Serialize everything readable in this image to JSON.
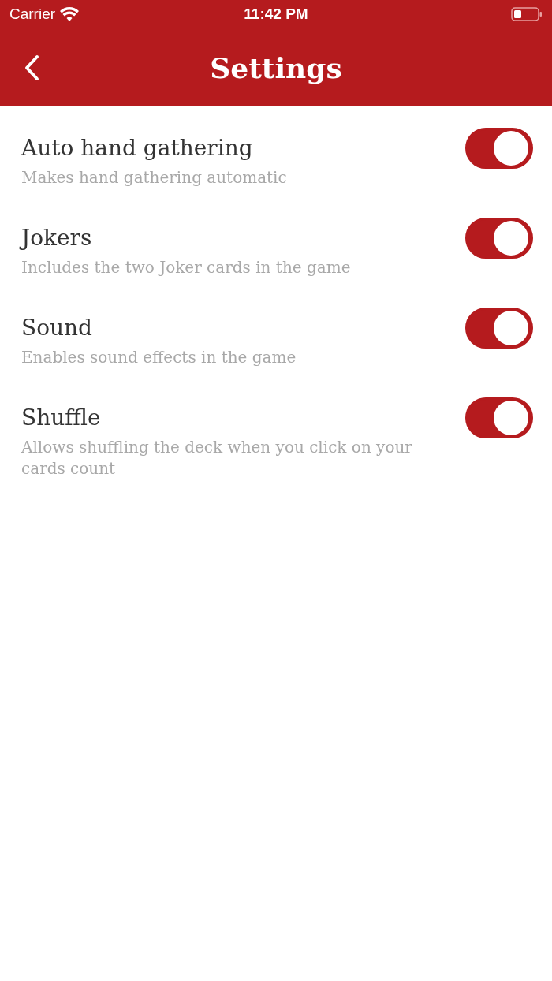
{
  "status_bar": {
    "carrier": "Carrier",
    "time": "11:42 PM"
  },
  "nav_bar": {
    "title": "Settings"
  },
  "settings": [
    {
      "title": "Auto hand gathering",
      "description": "Makes hand gathering automatic",
      "on": true
    },
    {
      "title": "Jokers",
      "description": "Includes the two Joker cards in the game",
      "on": true
    },
    {
      "title": "Sound",
      "description": "Enables sound effects in the game",
      "on": true
    },
    {
      "title": "Shuffle",
      "description": "Allows shuffling the deck when you click on your cards count",
      "on": true
    }
  ]
}
